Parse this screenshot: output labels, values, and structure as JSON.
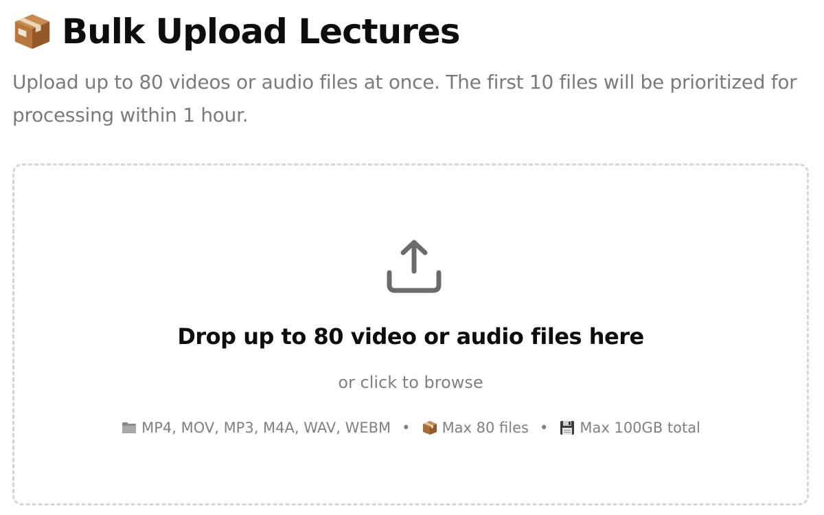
{
  "header": {
    "title": "Bulk Upload Lectures",
    "title_icon": "package-icon"
  },
  "subtitle": "Upload up to 80 videos or audio files at once. The first 10 files will be prioritized for processing within 1 hour.",
  "dropzone": {
    "icon": "upload-icon",
    "title": "Drop up to 80 video or audio files here",
    "browse_text": "or click to browse",
    "info": [
      {
        "icon": "folder-icon",
        "text": "MP4, MOV, MP3, M4A, WAV, WEBM"
      },
      {
        "icon": "package-icon",
        "text": "Max 80 files"
      },
      {
        "icon": "floppy-disk-icon",
        "text": "Max 100GB total"
      }
    ],
    "separator": "•"
  },
  "colors": {
    "title": "#0d0d0d",
    "muted_text": "#7a7a7a",
    "dropzone_border": "#d6d6d6",
    "upload_icon": "#6b6b6b"
  }
}
